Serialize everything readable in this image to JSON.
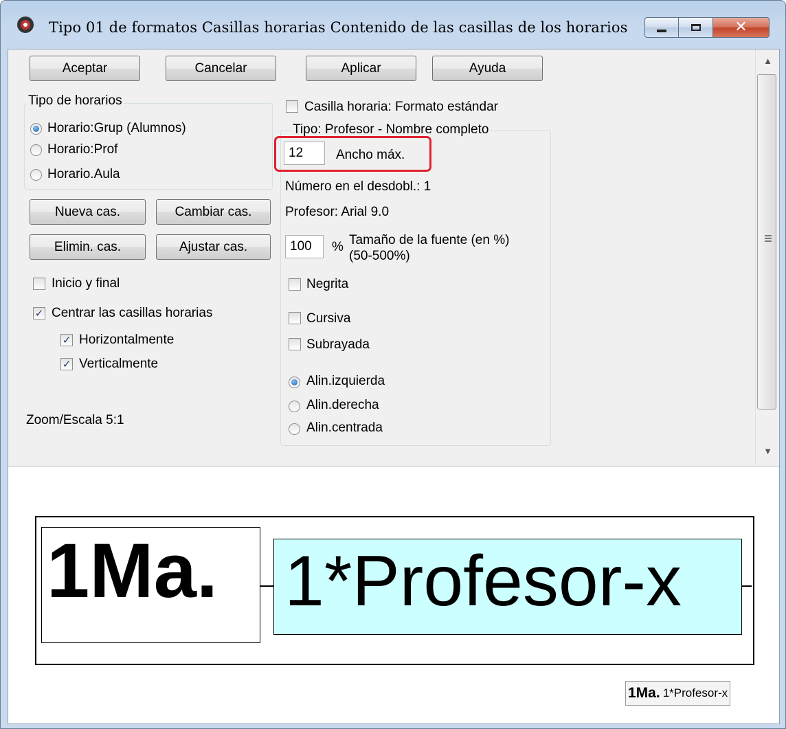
{
  "window": {
    "title": "Tipo 01 de formatos  Casillas horarias  Contenido de las casillas de los horarios",
    "controls": [
      "minimize",
      "maximize",
      "close"
    ]
  },
  "buttons": {
    "aceptar": "Aceptar",
    "cancelar": "Cancelar",
    "aplicar": "Aplicar",
    "ayuda": "Ayuda",
    "nueva": "Nueva cas.",
    "cambiar": "Cambiar cas.",
    "eliminar": "Elimin. cas.",
    "ajustar": "Ajustar cas."
  },
  "tipo_horarios": {
    "title": "Tipo de horarios",
    "options": [
      {
        "label": "Horario:Grup (Alumnos)",
        "selected": true
      },
      {
        "label": "Horario:Prof",
        "selected": false
      },
      {
        "label": "Horario.Aula",
        "selected": false
      }
    ]
  },
  "left_checks": {
    "inicio_final": {
      "label": "Inicio y final",
      "checked": false
    },
    "centrar": {
      "label": "Centrar las casillas horarias",
      "checked": true
    },
    "horizontal": {
      "label": "Horizontalmente",
      "checked": true
    },
    "vertical": {
      "label": "Verticalmente",
      "checked": true
    }
  },
  "zoom": {
    "label": "Zoom/Escala  5:1"
  },
  "right": {
    "estandar": {
      "label": "Casilla horaria: Formato estándar",
      "checked": false
    },
    "group_title": "Tipo: Profesor - Nombre completo",
    "ancho": {
      "value": "12",
      "label": "Ancho máx."
    },
    "numero": "Número en el desdobl.: 1",
    "profesor_font": "Profesor: Arial 9.0",
    "tamano": {
      "value": "100",
      "unit": "%",
      "label_line1": "Tamaño de la fuente (en %)",
      "label_line2": "(50-500%)"
    },
    "negrita": {
      "label": "Negrita",
      "checked": false
    },
    "cursiva": {
      "label": "Cursiva",
      "checked": false
    },
    "subrayada": {
      "label": "Subrayada",
      "checked": false
    },
    "alineacion": [
      {
        "label": "Alin.izquierda",
        "selected": true
      },
      {
        "label": "Alin.derecha",
        "selected": false
      },
      {
        "label": "Alin.centrada",
        "selected": false
      }
    ]
  },
  "preview": {
    "cell1": "1Ma.",
    "cell2": "1*Profesor-x",
    "mini_bold": "1Ma.",
    "mini_regular": "1*Profesor-x"
  },
  "colors": {
    "highlight": "#e02030",
    "preview_cell_bg": "#ccffff",
    "radio_selected": "#1f5fa8"
  }
}
